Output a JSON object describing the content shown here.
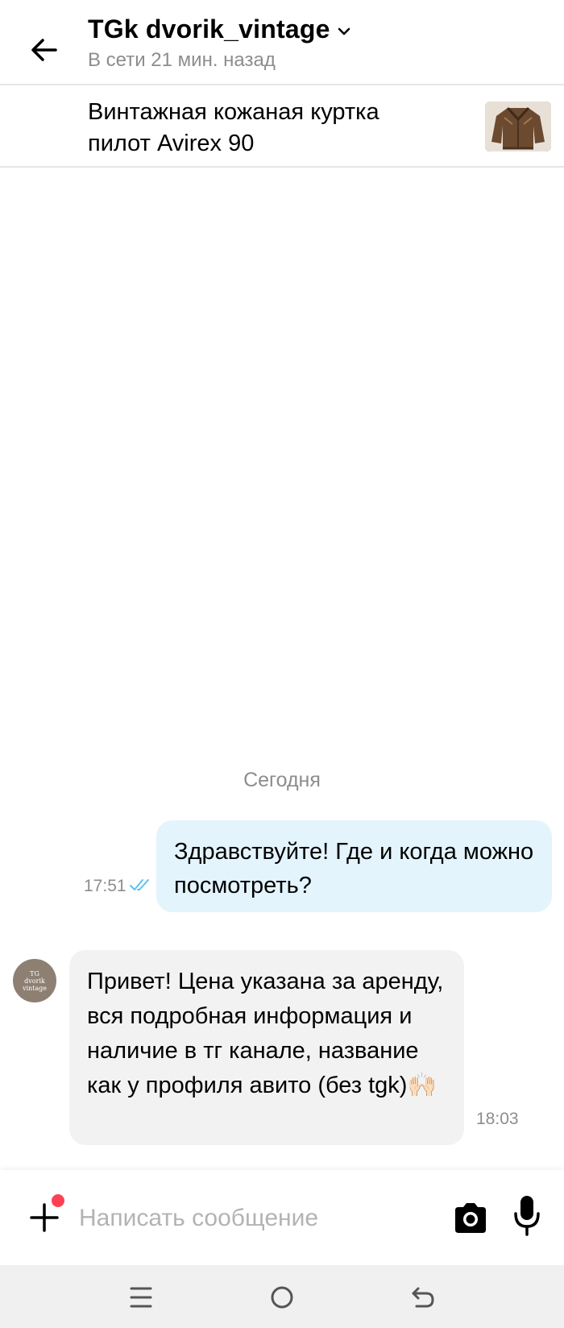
{
  "header": {
    "title": "TGk dvorik_vintage",
    "status": "В сети 21 мин. назад"
  },
  "listing": {
    "title": "Винтажная кожаная куртка пилот Avirex 90"
  },
  "chat": {
    "date_separator": "Сегодня",
    "messages": [
      {
        "direction": "outgoing",
        "text": "Здравствуйте! Где и когда можно посмотреть?",
        "time": "17:51",
        "status": "read"
      },
      {
        "direction": "incoming",
        "text": "Привет! Цена указана за аренду, вся подробная информация и наличие в тг канале, название как у профиля авито (без tgk)🙌🏻",
        "time": "18:03"
      }
    ],
    "avatar_text": [
      "TG",
      "dvorik",
      "vintage"
    ]
  },
  "composer": {
    "placeholder": "Написать сообщение"
  },
  "colors": {
    "outgoing_bubble": "#e3f4fd",
    "incoming_bubble": "#f2f2f2",
    "read_check": "#5ac2ef",
    "notification_dot": "#ff4053"
  },
  "icons": [
    "back-arrow-icon",
    "chevron-down-icon",
    "double-check-icon",
    "plus-icon",
    "camera-icon",
    "microphone-icon",
    "menu-icon",
    "home-icon",
    "back-icon"
  ]
}
